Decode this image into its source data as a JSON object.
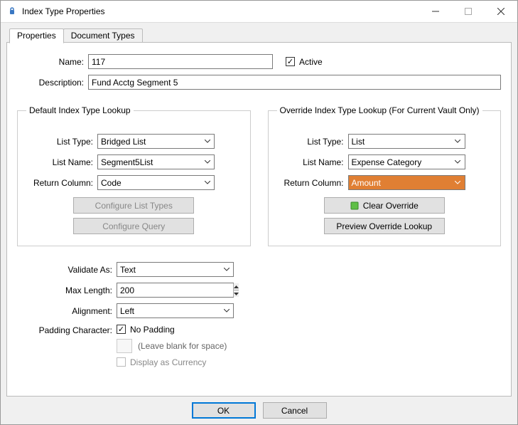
{
  "window": {
    "title": "Index Type Properties"
  },
  "tabs": {
    "properties": "Properties",
    "documentTypes": "Document Types"
  },
  "labels": {
    "name": "Name:",
    "description": "Description:",
    "active": "Active",
    "defaultGroup": "Default Index Type Lookup",
    "overrideGroup": "Override Index Type Lookup (For Current Vault Only)",
    "listType": "List Type:",
    "listName": "List Name:",
    "returnColumn": "Return Column:",
    "configureListTypes": "Configure List Types",
    "configureQuery": "Configure Query",
    "clearOverride": "Clear Override",
    "previewOverride": "Preview Override Lookup",
    "validateAs": "Validate As:",
    "maxLength": "Max Length:",
    "alignment": "Alignment:",
    "paddingCharacter": "Padding Character:",
    "noPadding": "No Padding",
    "leaveBlank": "(Leave blank for space)",
    "displayCurrency": "Display as Currency",
    "ok": "OK",
    "cancel": "Cancel"
  },
  "fields": {
    "name": "117",
    "description": "Fund Acctg Segment 5",
    "active": true,
    "default": {
      "listType": "Bridged List",
      "listName": "Segment5List",
      "returnColumn": "Code"
    },
    "override": {
      "listType": "List",
      "listName": "Expense Category",
      "returnColumn": "Amount"
    },
    "validateAs": "Text",
    "maxLength": "200",
    "alignment": "Left",
    "noPadding": true,
    "displayCurrency": false
  }
}
